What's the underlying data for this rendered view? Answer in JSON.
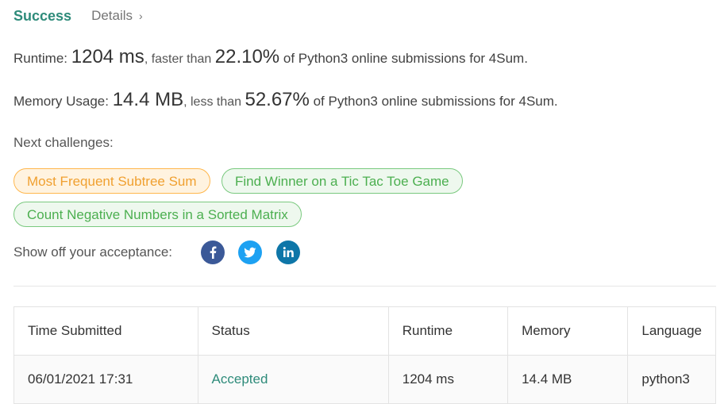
{
  "header": {
    "status": "Success",
    "details_label": "Details",
    "details_chevron": "›"
  },
  "runtime": {
    "label": "Runtime: ",
    "value": "1204 ms",
    "comparison": ", faster than ",
    "percent": "22.10%",
    "suffix": " of Python3 online submissions for 4Sum."
  },
  "memory": {
    "label": "Memory Usage: ",
    "value": "14.4 MB",
    "comparison": ", less than ",
    "percent": "52.67%",
    "suffix": " of Python3 online submissions for 4Sum."
  },
  "next_challenges": {
    "label": "Next challenges:",
    "items": [
      {
        "label": "Most Frequent Subtree Sum",
        "difficulty_color": "#f0a030"
      },
      {
        "label": "Find Winner on a Tic Tac Toe Game",
        "difficulty_color": "#4caf50"
      },
      {
        "label": "Count Negative Numbers in a Sorted Matrix",
        "difficulty_color": "#4caf50"
      }
    ]
  },
  "share": {
    "label": "Show off your acceptance:",
    "icons": [
      "facebook-icon",
      "twitter-icon",
      "linkedin-icon"
    ]
  },
  "submissions": {
    "headers": [
      "Time Submitted",
      "Status",
      "Runtime",
      "Memory",
      "Language"
    ],
    "rows": [
      {
        "time": "06/01/2021 17:31",
        "status": "Accepted",
        "runtime": "1204 ms",
        "memory": "14.4 MB",
        "language": "python3"
      }
    ]
  },
  "colors": {
    "accent": "#2e8b7a",
    "medium": "#f0a030",
    "easy": "#4caf50"
  }
}
